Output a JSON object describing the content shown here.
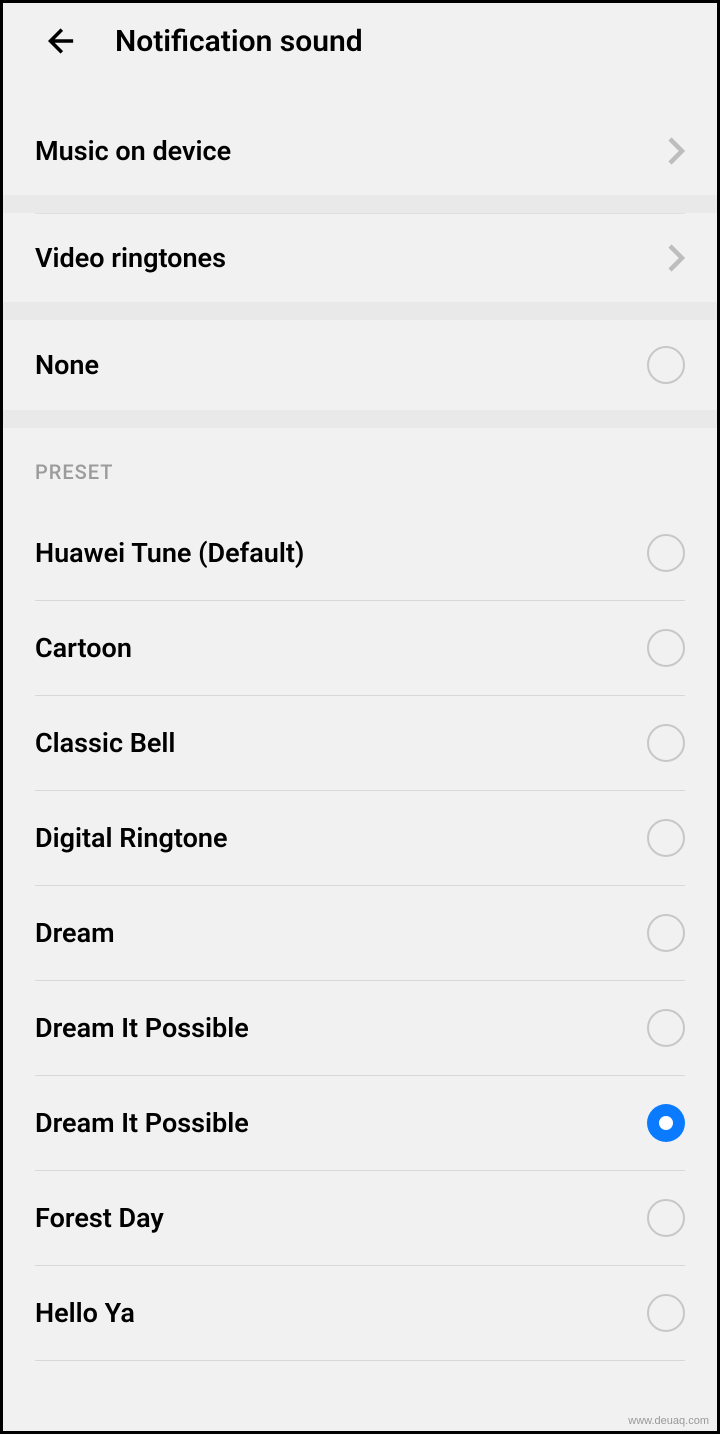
{
  "header": {
    "title": "Notification sound"
  },
  "nav": {
    "music": "Music on device",
    "video": "Video ringtones"
  },
  "none": {
    "label": "None",
    "selected": false
  },
  "section": {
    "preset": "PRESET"
  },
  "presets": [
    {
      "label": "Huawei Tune (Default)",
      "selected": false
    },
    {
      "label": "Cartoon",
      "selected": false
    },
    {
      "label": "Classic Bell",
      "selected": false
    },
    {
      "label": "Digital Ringtone",
      "selected": false
    },
    {
      "label": "Dream",
      "selected": false
    },
    {
      "label": "Dream It Possible",
      "selected": false
    },
    {
      "label": "Dream It Possible",
      "selected": true
    },
    {
      "label": "Forest Day",
      "selected": false
    },
    {
      "label": "Hello Ya",
      "selected": false
    }
  ],
  "watermark": "www.deuaq.com"
}
